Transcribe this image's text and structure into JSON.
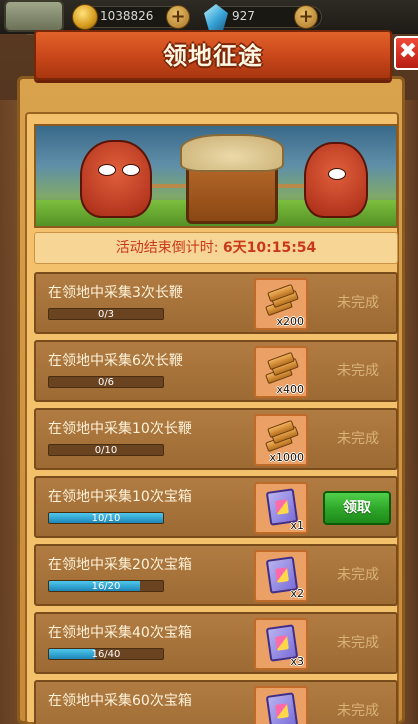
{
  "topbar": {
    "coins": "1038826",
    "gems": "927"
  },
  "dialog": {
    "title": "领地征途",
    "close_label": "✖"
  },
  "countdown": {
    "label": "活动结束倒计时:",
    "value": "6天10:15:54"
  },
  "tasks": [
    {
      "title": "在领地中采集3次长鞭",
      "progress_text": "0/3",
      "progress": 0.0,
      "reward_type": "wood",
      "reward_count": "x200",
      "status": "未完成"
    },
    {
      "title": "在领地中采集6次长鞭",
      "progress_text": "0/6",
      "progress": 0.0,
      "reward_type": "wood",
      "reward_count": "x400",
      "status": "未完成"
    },
    {
      "title": "在领地中采集10次长鞭",
      "progress_text": "0/10",
      "progress": 0.0,
      "reward_type": "wood",
      "reward_count": "x1000",
      "status": "未完成"
    },
    {
      "title": "在领地中采集10次宝箱",
      "progress_text": "10/10",
      "progress": 1.0,
      "reward_type": "book",
      "reward_count": "x1",
      "status": "领取"
    },
    {
      "title": "在领地中采集20次宝箱",
      "progress_text": "16/20",
      "progress": 0.8,
      "reward_type": "book",
      "reward_count": "x2",
      "status": "未完成"
    },
    {
      "title": "在领地中采集40次宝箱",
      "progress_text": "16/40",
      "progress": 0.4,
      "reward_type": "book",
      "reward_count": "x3",
      "status": "未完成"
    },
    {
      "title": "在领地中采集60次宝箱",
      "progress_text": "",
      "progress": 0.0,
      "reward_type": "book",
      "reward_count": "",
      "status": "未完成"
    }
  ]
}
